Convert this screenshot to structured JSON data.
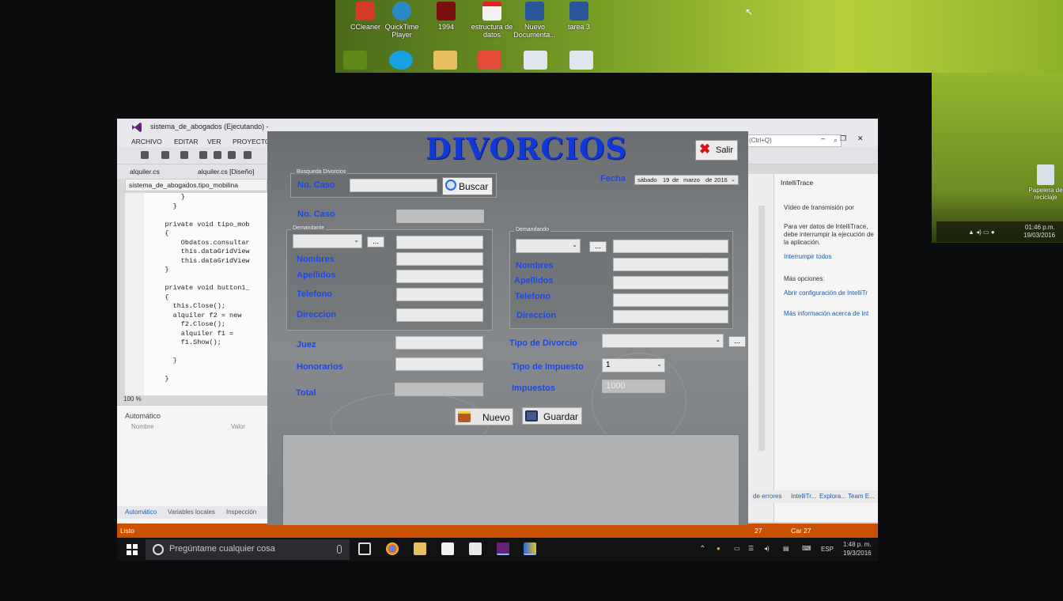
{
  "desktop": {
    "icons_row1": [
      "CCleaner",
      "QuickTime Player",
      "1994",
      "estructura de datos",
      "Nuevo Documenta...",
      "tarea 3"
    ],
    "recycle_bin": "Papelera de reciclaje",
    "tray_time": "01:46 p.m.",
    "tray_date": "19/03/2016"
  },
  "ide": {
    "title": "sistema_de_abogados (Ejecutando) -",
    "menu": [
      "ARCHIVO",
      "EDITAR",
      "VER",
      "PROYECTO"
    ],
    "quick_launch": "(Ctrl+Q)",
    "tabs": [
      "alquiler.cs",
      "alquiler.cs [Diseño]"
    ],
    "nav": "sistema_de_abogados.tipo_mobilina",
    "code": "        }\n      }\n\n    private void tipo_mob\n    {\n        Obdatos.consultar\n        this.dataGridView\n        this.dataGridView\n    }\n\n    private void button1_\n    {\n      this.Close();\n      alquiler f2 = new\n        f2.Close();\n        alquiler f1 =\n        f1.Show();\n\n      }\n\n    }",
    "zoom": "100 %",
    "auto_panel": {
      "title": "Automático",
      "col_name": "Nombre",
      "col_value": "Valor"
    },
    "bottom_tabs": [
      "Automático",
      "Variables locales",
      "Inspección"
    ],
    "status": {
      "left": "Listo",
      "col": "Car 27",
      "extra": "27"
    },
    "intellitrace": {
      "title": "IntelliTrace",
      "video": "Vídeo de transmisión por",
      "desc": "Para ver datos de IntelliTrace, debe interrumpir la ejecución de la aplicación.",
      "pause": "Interrumpir todos",
      "more": "Más opciones:",
      "link1": "Abrir configuración de IntelliTr",
      "link2": "Más información acerca de Int"
    },
    "right_tabs": [
      "de errores",
      "IntelliTr...",
      "Explora...",
      "Team E..."
    ]
  },
  "form": {
    "title": "DIVORCIOS",
    "salir": "Salir",
    "search_group": "Busqueda Divorcios",
    "search_label": "No. Caso",
    "search_value": "",
    "buscar": "Buscar",
    "fecha_label": "Fecha",
    "fecha": {
      "day": "sábado",
      "num": "19",
      "sep": "de",
      "month": "marzo",
      "year": "2016"
    },
    "no_caso_label": "No. Caso",
    "demandante": {
      "caption": "Demandante",
      "labels": [
        "Nombres",
        "Apellidos",
        "Telefono",
        "Direccion"
      ]
    },
    "demandado": {
      "caption": "Demandando",
      "labels": [
        "Nombres",
        "Apellidos",
        "Telefono",
        "Direccion"
      ]
    },
    "juez_label": "Juez",
    "honorarios_label": "Honorarios",
    "total_label": "Total",
    "tipo_divorcio_label": "Tipo de Divorcio",
    "tipo_impuesto_label": "Tipo de Impuesto",
    "tipo_impuesto_value": "1",
    "impuestos_label": "Impuestos",
    "impuestos_value": "1000",
    "nuevo": "Nuevo",
    "guardar": "Guardar",
    "colors": {
      "title": "#1038d8",
      "label": "#1c48e8",
      "panel": "#7c8082"
    }
  },
  "taskbar": {
    "search": "Pregúntame cualquier cosa",
    "lang": "ESP",
    "time": "1:48 p. m.",
    "date": "19/3/2016"
  }
}
